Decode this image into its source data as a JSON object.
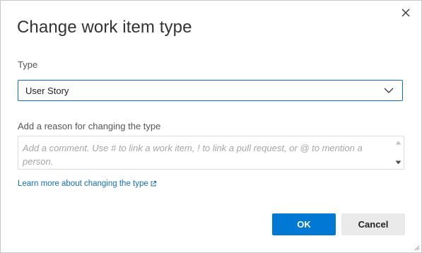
{
  "dialog": {
    "title": "Change work item type",
    "close_icon": "close-icon"
  },
  "type_field": {
    "label": "Type",
    "selected_value": "User Story",
    "dropdown_icon": "chevron-down-icon"
  },
  "reason_field": {
    "label": "Add a reason for changing the type",
    "value": "",
    "placeholder": "Add a comment. Use # to link a work item, ! to link a pull request, or @ to mention a person."
  },
  "learn_more": {
    "text": "Learn more about changing the type",
    "icon": "external-link-icon"
  },
  "buttons": {
    "ok_label": "OK",
    "cancel_label": "Cancel"
  },
  "colors": {
    "accent": "#0078d4",
    "link": "#106ebe",
    "focus_border": "#106ebe",
    "cancel_bg": "#eaeaea"
  }
}
